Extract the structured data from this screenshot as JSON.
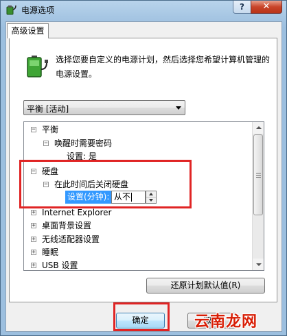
{
  "window": {
    "title": "电源选项",
    "help_label": "?",
    "close_label": "✕"
  },
  "tab": {
    "label": "高级设置"
  },
  "description": "选择您要自定义的电源计划，然后选择您希望计算机管理的电源设置。",
  "plan_select": {
    "value": "平衡 [活动]"
  },
  "tree": {
    "items": [
      {
        "label": "平衡",
        "expander": "−"
      },
      {
        "label": "唤醒时需要密码",
        "expander": "−"
      },
      {
        "label": "设置: 是"
      },
      {
        "label": "硬盘",
        "expander": "−"
      },
      {
        "label": "在此时间后关闭硬盘",
        "expander": "−"
      },
      {
        "label": "设置(分钟):"
      },
      {
        "label": "Internet Explorer",
        "expander": "+"
      },
      {
        "label": "桌面背景设置",
        "expander": "+"
      },
      {
        "label": "无线适配器设置",
        "expander": "+"
      },
      {
        "label": "睡眠",
        "expander": "+"
      },
      {
        "label": "USB 设置",
        "expander": "+"
      }
    ],
    "setting_value": "从不"
  },
  "buttons": {
    "restore": "还原计划默认值(R)",
    "ok": "确定",
    "cancel": "取消"
  },
  "watermark": "云南龙网",
  "colors": {
    "highlight": "#3399ff",
    "annotation": "#e02424"
  }
}
